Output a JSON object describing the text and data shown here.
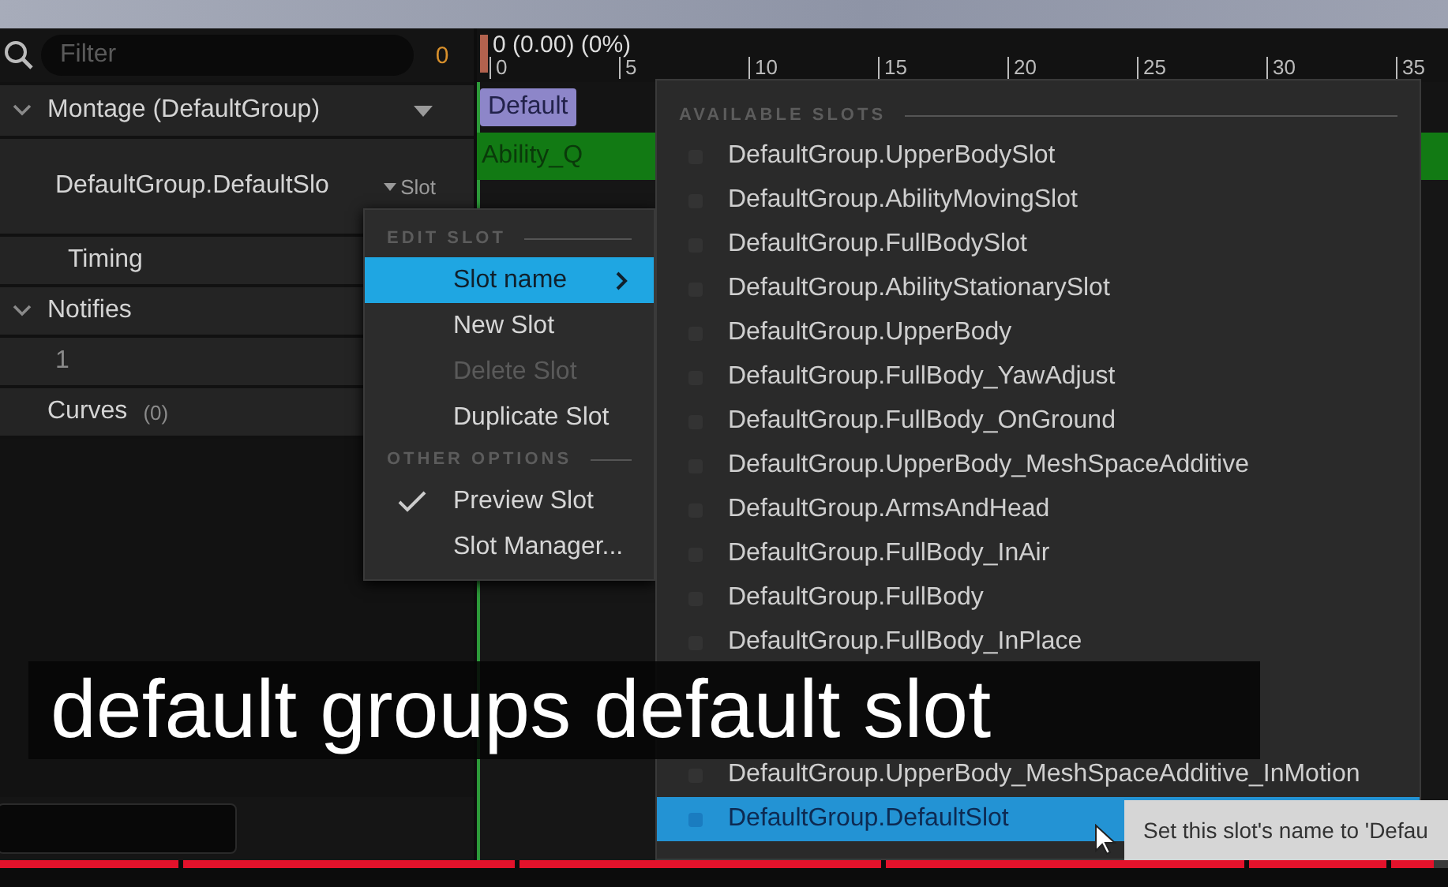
{
  "filter": {
    "placeholder": "Filter",
    "count": "0"
  },
  "montage": {
    "label": "Montage (DefaultGroup)",
    "expanded": true
  },
  "slot_row": {
    "name": "DefaultGroup.DefaultSlo",
    "button": "Slot"
  },
  "timing": {
    "label": "Timing"
  },
  "notifies": {
    "label": "Notifies",
    "expanded": true,
    "track": "1"
  },
  "curves": {
    "label": "Curves",
    "count": "(0)"
  },
  "timeline": {
    "position": "0 (0.00) (0%)",
    "ticks": [
      "0",
      "5",
      "10",
      "15",
      "20",
      "25",
      "30",
      "35"
    ],
    "section": "Default",
    "segment": "Ability_Q"
  },
  "context_menu": {
    "sections": [
      {
        "heading": "EDIT SLOT",
        "items": [
          {
            "label": "Slot name",
            "selected": true,
            "disabled": false,
            "checked": false,
            "submenu": true
          },
          {
            "label": "New Slot",
            "selected": false,
            "disabled": false,
            "checked": false,
            "submenu": false
          },
          {
            "label": "Delete Slot",
            "selected": false,
            "disabled": true,
            "checked": false,
            "submenu": false
          },
          {
            "label": "Duplicate Slot",
            "selected": false,
            "disabled": false,
            "checked": false,
            "submenu": false
          }
        ]
      },
      {
        "heading": "OTHER OPTIONS",
        "items": [
          {
            "label": "Preview Slot",
            "selected": false,
            "disabled": false,
            "checked": true,
            "submenu": false
          },
          {
            "label": "Slot Manager...",
            "selected": false,
            "disabled": false,
            "checked": false,
            "submenu": false
          }
        ]
      }
    ]
  },
  "slots_menu": {
    "heading": "AVAILABLE SLOTS",
    "items": [
      {
        "label": "DefaultGroup.UpperBodySlot",
        "selected": false
      },
      {
        "label": "DefaultGroup.AbilityMovingSlot",
        "selected": false
      },
      {
        "label": "DefaultGroup.FullBodySlot",
        "selected": false
      },
      {
        "label": "DefaultGroup.AbilityStationarySlot",
        "selected": false
      },
      {
        "label": "DefaultGroup.UpperBody",
        "selected": false
      },
      {
        "label": "DefaultGroup.FullBody_YawAdjust",
        "selected": false
      },
      {
        "label": "DefaultGroup.FullBody_OnGround",
        "selected": false
      },
      {
        "label": "DefaultGroup.UpperBody_MeshSpaceAdditive",
        "selected": false
      },
      {
        "label": "DefaultGroup.ArmsAndHead",
        "selected": false
      },
      {
        "label": "DefaultGroup.FullBody_InAir",
        "selected": false
      },
      {
        "label": "DefaultGroup.FullBody",
        "selected": false
      },
      {
        "label": "DefaultGroup.FullBody_InPlace",
        "selected": false
      }
    ],
    "lower_items": [
      {
        "label": "DefaultGroup.UpperBody_MeshSpaceAdditive_InMotion",
        "selected": false
      },
      {
        "label": "DefaultGroup.DefaultSlot",
        "selected": true
      }
    ]
  },
  "tooltip": "Set this slot's name to 'Defau",
  "caption": "default groups default slot",
  "video_progress": {
    "level": 0.99
  }
}
